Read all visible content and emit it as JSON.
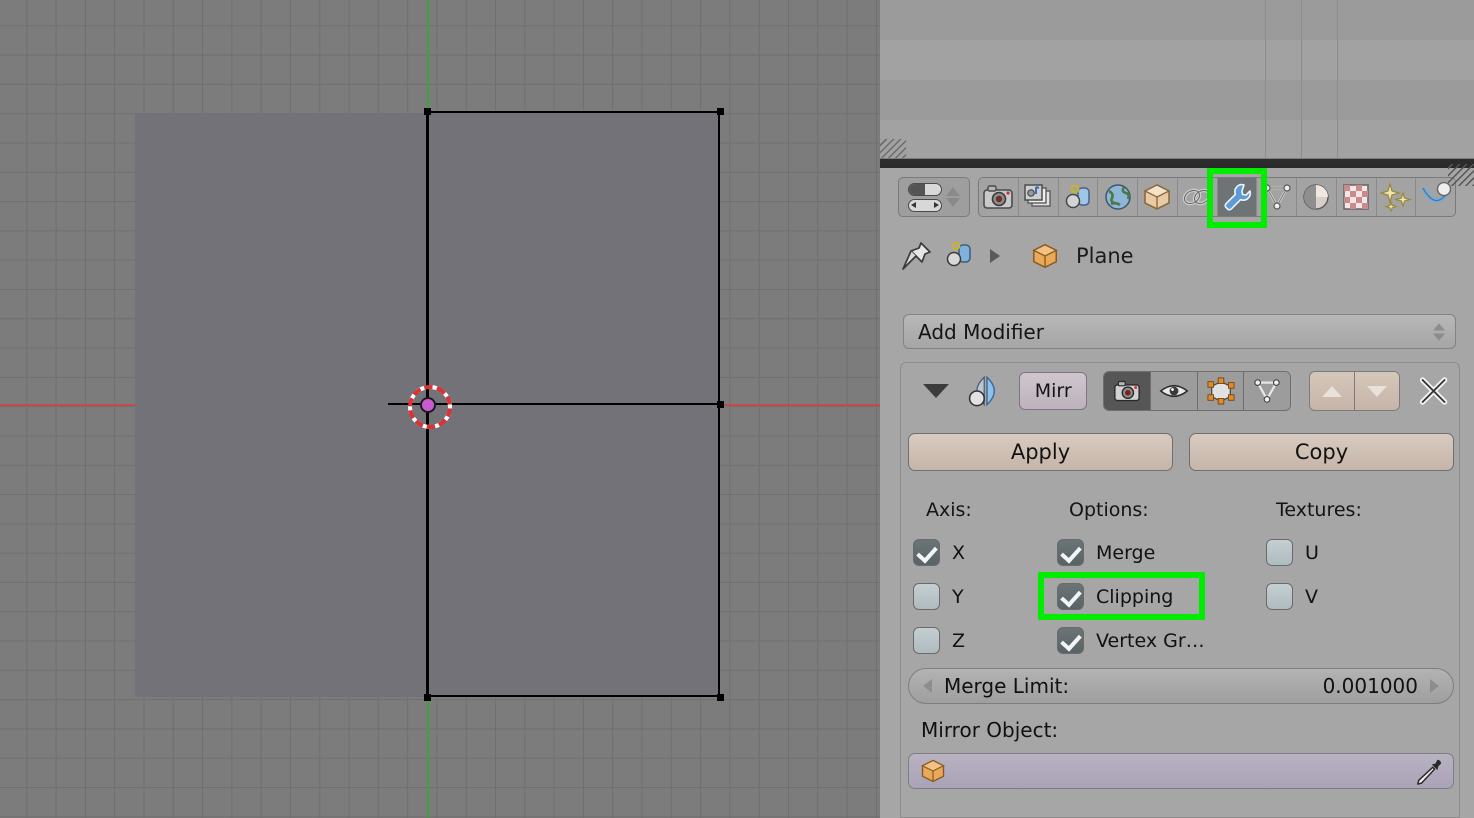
{
  "app": {
    "name": "Blender",
    "editor_left": "3D Viewport",
    "editor_right": "Properties"
  },
  "viewport": {
    "object_name": "Plane",
    "axis_x_color": "#c34b4b",
    "axis_y_color": "#3ca33c",
    "background_color": "#7c7c7c",
    "grid_line_color": "#6f6f6f",
    "mesh_face_color": "#737278",
    "wire_color": "#000000",
    "cursor_label": "3d-cursor"
  },
  "properties": {
    "editor_type_label": "Editor Type",
    "tabs": [
      {
        "name": "render",
        "icon": "camera-icon",
        "active": false
      },
      {
        "name": "scene-render-layers",
        "icon": "photos-icon",
        "active": false
      },
      {
        "name": "scene",
        "icon": "scene-icon",
        "active": false
      },
      {
        "name": "world",
        "icon": "globe-icon",
        "active": false
      },
      {
        "name": "object",
        "icon": "cube-icon",
        "active": false
      },
      {
        "name": "constraints",
        "icon": "chain-icon",
        "active": false
      },
      {
        "name": "modifiers",
        "icon": "wrench-icon",
        "active": true
      },
      {
        "name": "object-data",
        "icon": "triangle-mesh-icon",
        "active": false
      },
      {
        "name": "material",
        "icon": "sphere-icon",
        "active": false
      },
      {
        "name": "texture",
        "icon": "checker-icon",
        "active": false
      },
      {
        "name": "particles",
        "icon": "sparkles-icon",
        "active": false
      },
      {
        "name": "physics",
        "icon": "orbit-icon",
        "active": false
      }
    ],
    "breadcrumb": {
      "pin_icon": "pin-icon",
      "context_icon": "object-data-icon",
      "separator": "▸",
      "object_icon": "cube-icon",
      "object_name": "Plane"
    },
    "add_modifier": {
      "label": "Add Modifier"
    },
    "modifier": {
      "expand_icon": "collapse-triangle-icon",
      "type_icon": "mirror-modifier-icon",
      "name": "Mirr",
      "display_toggles": [
        {
          "name": "render",
          "icon": "camera-icon",
          "enabled": true
        },
        {
          "name": "realtime",
          "icon": "eye-icon",
          "enabled": false
        },
        {
          "name": "edit-mode",
          "icon": "edit-mode-icon",
          "enabled": false
        },
        {
          "name": "on-cage",
          "icon": "on-cage-icon",
          "enabled": false
        }
      ],
      "move_up_label": "Move Up",
      "move_down_label": "Move Down",
      "close_label": "Delete Modifier",
      "apply_label": "Apply",
      "copy_label": "Copy",
      "columns": {
        "axis_header": "Axis:",
        "options_header": "Options:",
        "textures_header": "Textures:"
      },
      "axis": [
        {
          "label": "X",
          "checked": true
        },
        {
          "label": "Y",
          "checked": false
        },
        {
          "label": "Z",
          "checked": false
        }
      ],
      "options": [
        {
          "label": "Merge",
          "checked": true
        },
        {
          "label": "Clipping",
          "checked": true,
          "highlighted": true
        },
        {
          "label": "Vertex Gr…",
          "checked": true
        }
      ],
      "textures": [
        {
          "label": "U",
          "checked": false
        },
        {
          "label": "V",
          "checked": false
        }
      ],
      "merge_limit": {
        "label": "Merge Limit:",
        "value": "0.001000"
      },
      "mirror_object": {
        "label": "Mirror Object:",
        "value": "",
        "object_icon": "cube-icon",
        "picker_icon": "eyedropper-icon"
      }
    }
  },
  "annotations": {
    "highlight_color": "#00ec00",
    "boxes": [
      {
        "name": "modifiers-tab-highlight",
        "target": "wrench-icon"
      },
      {
        "name": "clipping-option-highlight",
        "target": "Clipping"
      }
    ]
  }
}
